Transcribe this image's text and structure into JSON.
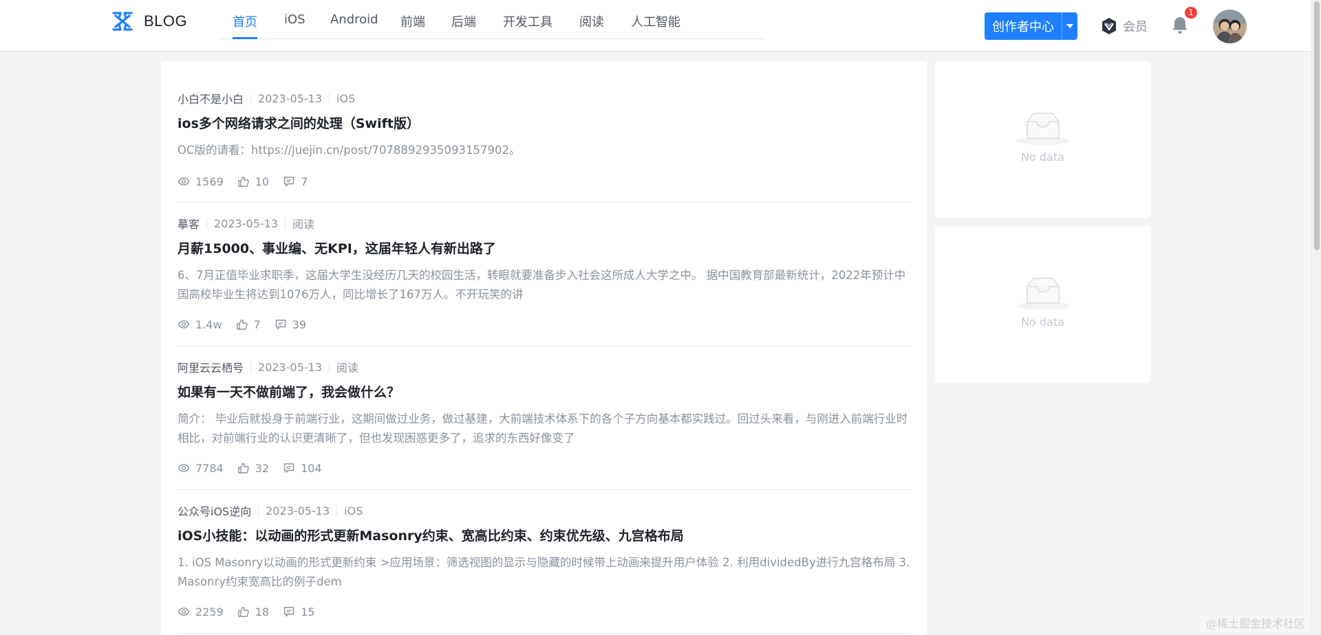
{
  "header": {
    "logo_text": "BLOG",
    "nav": [
      "首页",
      "iOS",
      "Android",
      "前端",
      "后端",
      "开发工具",
      "阅读",
      "人工智能"
    ],
    "creator_label": "创作者中心",
    "vip_label": "会员",
    "notification_count": "1"
  },
  "articles": [
    {
      "author": "小白不是小白",
      "date": "2023-05-13",
      "tag": "iOS",
      "title": "ios多个网络请求之间的处理（Swift版）",
      "abstract": "OC版的请看：https://juejin.cn/post/7078892935093157902。",
      "views": "1569",
      "likes": "10",
      "comments": "7"
    },
    {
      "author": "摹客",
      "date": "2023-05-13",
      "tag": "阅读",
      "title": "月薪15000、事业编、无KPI，这届年轻人有新出路了",
      "abstract": "6、7月正值毕业求职季，这届大学生没经历几天的校园生活，转眼就要准备步入社会这所成人大学之中。 据中国教育部最新统计，2022年预计中国高校毕业生将达到1076万人，同比增长了167万人。不开玩笑的讲",
      "views": "1.4w",
      "likes": "7",
      "comments": "39"
    },
    {
      "author": "阿里云云栖号",
      "date": "2023-05-13",
      "tag": "阅读",
      "title": "如果有一天不做前端了，我会做什么？",
      "abstract": "简介： 毕业后就投身于前端行业，这期间做过业务，做过基建，大前端技术体系下的各个子方向基本都实践过。回过头来看，与刚进入前端行业时相比，对前端行业的认识更清晰了，但也发现困惑更多了，追求的东西好像变了",
      "views": "7784",
      "likes": "32",
      "comments": "104"
    },
    {
      "author": "公众号iOS逆向",
      "date": "2023-05-13",
      "tag": "iOS",
      "title": "iOS小技能：以动画的形式更新Masonry约束、宽高比约束、约束优先级、九宫格布局",
      "abstract": "1. iOS Masonry以动画的形式更新约束 >应用场景：筛选视图的显示与隐藏的时候带上动画来提升用户体验 2. 利用dividedBy进行九宫格布局 3. Masonry约束宽高比的例子dem",
      "views": "2259",
      "likes": "18",
      "comments": "15"
    }
  ],
  "sidebar": {
    "empty_text_1": "No data",
    "empty_text_2": "No data"
  },
  "watermark": "@稀土掘金技术社区",
  "colors": {
    "accent": "#1e80ff",
    "badge": "#f53f3f",
    "page_bg": "#f4f5f5"
  }
}
